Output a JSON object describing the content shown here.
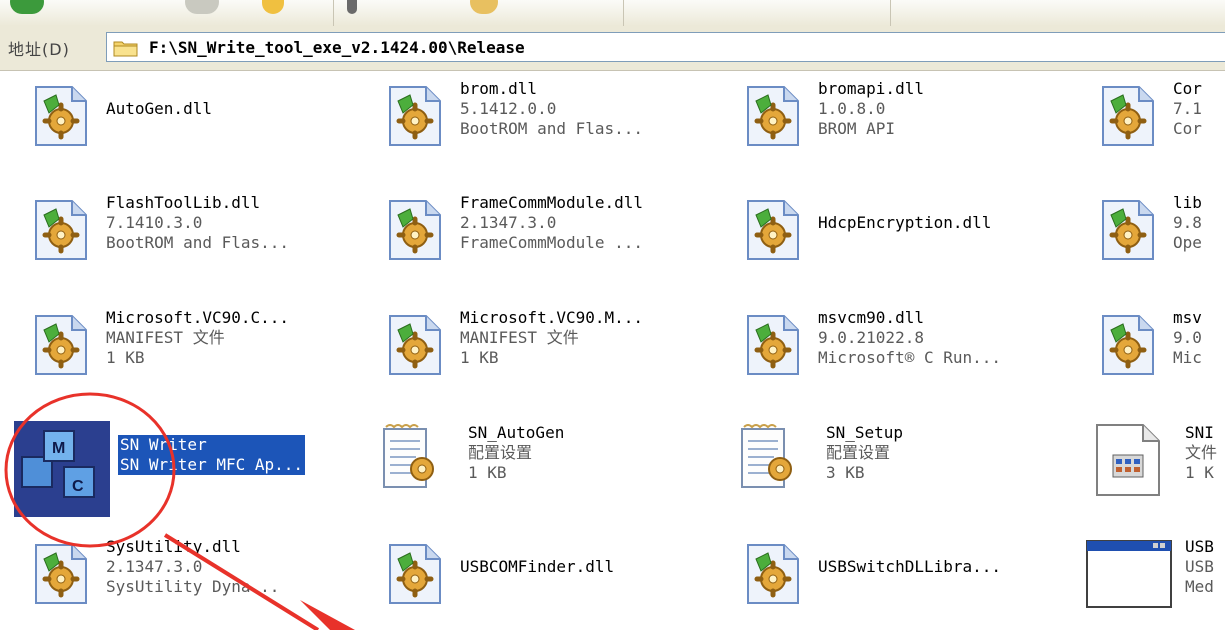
{
  "address_bar": {
    "label": "地址(D)",
    "path": "F:\\SN_Write_tool_exe_v2.1424.00\\Release"
  },
  "files": [
    {
      "lines": [
        "AutoGen.dll"
      ],
      "icon": "dll-gear-icon"
    },
    {
      "lines": [
        "brom.dll",
        "5.1412.0.0",
        "BootROM and Flas..."
      ],
      "icon": "dll-gear-icon"
    },
    {
      "lines": [
        "bromapi.dll",
        "1.0.8.0",
        "BROM API"
      ],
      "icon": "dll-gear-icon"
    },
    {
      "lines": [
        "Cor",
        "7.1",
        "Cor"
      ],
      "icon": "dll-gear-icon"
    },
    {
      "lines": [
        "FlashToolLib.dll",
        "7.1410.3.0",
        "BootROM and Flas..."
      ],
      "icon": "dll-gear-icon"
    },
    {
      "lines": [
        "FrameCommModule.dll",
        "2.1347.3.0",
        "FrameCommModule ..."
      ],
      "icon": "dll-gear-icon"
    },
    {
      "lines": [
        "HdcpEncryption.dll"
      ],
      "icon": "dll-gear-icon"
    },
    {
      "lines": [
        "lib",
        "9.8",
        "Ope"
      ],
      "icon": "dll-gear-icon"
    },
    {
      "lines": [
        "Microsoft.VC90.C...",
        "MANIFEST 文件",
        "1 KB"
      ],
      "icon": "dll-gear-icon"
    },
    {
      "lines": [
        "Microsoft.VC90.M...",
        "MANIFEST 文件",
        "1 KB"
      ],
      "icon": "dll-gear-icon"
    },
    {
      "lines": [
        "msvcm90.dll",
        "9.0.21022.8",
        "Microsoft® C Run..."
      ],
      "icon": "dll-gear-icon"
    },
    {
      "lines": [
        "msv",
        "9.0",
        "Mic"
      ],
      "icon": "dll-gear-icon"
    },
    {
      "lines": [
        "SN Writer",
        "SN Writer MFC Ap..."
      ],
      "icon": "mfc-app-icon",
      "selected": true
    },
    {
      "lines": [
        "SN_AutoGen",
        "配置设置",
        "1 KB"
      ],
      "icon": "config-ini-icon"
    },
    {
      "lines": [
        "SN_Setup",
        "配置设置",
        "3 KB"
      ],
      "icon": "config-ini-icon"
    },
    {
      "lines": [
        "SNI",
        "文件",
        "1 K"
      ],
      "icon": "text-file-icon"
    },
    {
      "lines": [
        "SysUtility.dll",
        "2.1347.3.0",
        "SysUtility Dyna..."
      ],
      "icon": "dll-gear-icon"
    },
    {
      "lines": [
        "USBCOMFinder.dll"
      ],
      "icon": "dll-gear-icon"
    },
    {
      "lines": [
        "USBSwitchDLLibra..."
      ],
      "icon": "dll-gear-icon"
    },
    {
      "lines": [
        "USB",
        "USB",
        "Med"
      ],
      "icon": "window-exe-icon"
    }
  ],
  "colors": {
    "selection": "#1c55b8",
    "annotation_red": "#e8322a"
  }
}
